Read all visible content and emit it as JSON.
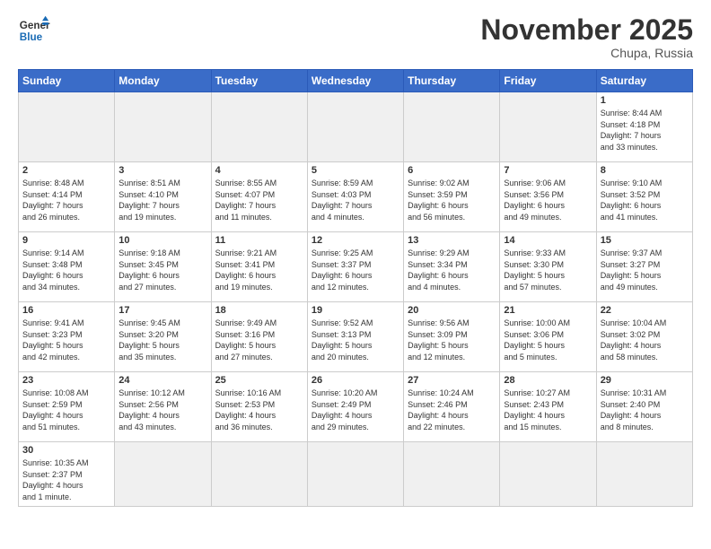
{
  "header": {
    "logo_text_normal": "General",
    "logo_text_bold": "Blue",
    "month_title": "November 2025",
    "location": "Chupa, Russia"
  },
  "weekdays": [
    "Sunday",
    "Monday",
    "Tuesday",
    "Wednesday",
    "Thursday",
    "Friday",
    "Saturday"
  ],
  "weeks": [
    [
      {
        "num": "",
        "info": "",
        "empty": true
      },
      {
        "num": "",
        "info": "",
        "empty": true
      },
      {
        "num": "",
        "info": "",
        "empty": true
      },
      {
        "num": "",
        "info": "",
        "empty": true
      },
      {
        "num": "",
        "info": "",
        "empty": true
      },
      {
        "num": "",
        "info": "",
        "empty": true
      },
      {
        "num": "1",
        "info": "Sunrise: 8:44 AM\nSunset: 4:18 PM\nDaylight: 7 hours\nand 33 minutes.",
        "empty": false
      }
    ],
    [
      {
        "num": "2",
        "info": "Sunrise: 8:48 AM\nSunset: 4:14 PM\nDaylight: 7 hours\nand 26 minutes.",
        "empty": false
      },
      {
        "num": "3",
        "info": "Sunrise: 8:51 AM\nSunset: 4:10 PM\nDaylight: 7 hours\nand 19 minutes.",
        "empty": false
      },
      {
        "num": "4",
        "info": "Sunrise: 8:55 AM\nSunset: 4:07 PM\nDaylight: 7 hours\nand 11 minutes.",
        "empty": false
      },
      {
        "num": "5",
        "info": "Sunrise: 8:59 AM\nSunset: 4:03 PM\nDaylight: 7 hours\nand 4 minutes.",
        "empty": false
      },
      {
        "num": "6",
        "info": "Sunrise: 9:02 AM\nSunset: 3:59 PM\nDaylight: 6 hours\nand 56 minutes.",
        "empty": false
      },
      {
        "num": "7",
        "info": "Sunrise: 9:06 AM\nSunset: 3:56 PM\nDaylight: 6 hours\nand 49 minutes.",
        "empty": false
      },
      {
        "num": "8",
        "info": "Sunrise: 9:10 AM\nSunset: 3:52 PM\nDaylight: 6 hours\nand 41 minutes.",
        "empty": false
      }
    ],
    [
      {
        "num": "9",
        "info": "Sunrise: 9:14 AM\nSunset: 3:48 PM\nDaylight: 6 hours\nand 34 minutes.",
        "empty": false
      },
      {
        "num": "10",
        "info": "Sunrise: 9:18 AM\nSunset: 3:45 PM\nDaylight: 6 hours\nand 27 minutes.",
        "empty": false
      },
      {
        "num": "11",
        "info": "Sunrise: 9:21 AM\nSunset: 3:41 PM\nDaylight: 6 hours\nand 19 minutes.",
        "empty": false
      },
      {
        "num": "12",
        "info": "Sunrise: 9:25 AM\nSunset: 3:37 PM\nDaylight: 6 hours\nand 12 minutes.",
        "empty": false
      },
      {
        "num": "13",
        "info": "Sunrise: 9:29 AM\nSunset: 3:34 PM\nDaylight: 6 hours\nand 4 minutes.",
        "empty": false
      },
      {
        "num": "14",
        "info": "Sunrise: 9:33 AM\nSunset: 3:30 PM\nDaylight: 5 hours\nand 57 minutes.",
        "empty": false
      },
      {
        "num": "15",
        "info": "Sunrise: 9:37 AM\nSunset: 3:27 PM\nDaylight: 5 hours\nand 49 minutes.",
        "empty": false
      }
    ],
    [
      {
        "num": "16",
        "info": "Sunrise: 9:41 AM\nSunset: 3:23 PM\nDaylight: 5 hours\nand 42 minutes.",
        "empty": false
      },
      {
        "num": "17",
        "info": "Sunrise: 9:45 AM\nSunset: 3:20 PM\nDaylight: 5 hours\nand 35 minutes.",
        "empty": false
      },
      {
        "num": "18",
        "info": "Sunrise: 9:49 AM\nSunset: 3:16 PM\nDaylight: 5 hours\nand 27 minutes.",
        "empty": false
      },
      {
        "num": "19",
        "info": "Sunrise: 9:52 AM\nSunset: 3:13 PM\nDaylight: 5 hours\nand 20 minutes.",
        "empty": false
      },
      {
        "num": "20",
        "info": "Sunrise: 9:56 AM\nSunset: 3:09 PM\nDaylight: 5 hours\nand 12 minutes.",
        "empty": false
      },
      {
        "num": "21",
        "info": "Sunrise: 10:00 AM\nSunset: 3:06 PM\nDaylight: 5 hours\nand 5 minutes.",
        "empty": false
      },
      {
        "num": "22",
        "info": "Sunrise: 10:04 AM\nSunset: 3:02 PM\nDaylight: 4 hours\nand 58 minutes.",
        "empty": false
      }
    ],
    [
      {
        "num": "23",
        "info": "Sunrise: 10:08 AM\nSunset: 2:59 PM\nDaylight: 4 hours\nand 51 minutes.",
        "empty": false
      },
      {
        "num": "24",
        "info": "Sunrise: 10:12 AM\nSunset: 2:56 PM\nDaylight: 4 hours\nand 43 minutes.",
        "empty": false
      },
      {
        "num": "25",
        "info": "Sunrise: 10:16 AM\nSunset: 2:53 PM\nDaylight: 4 hours\nand 36 minutes.",
        "empty": false
      },
      {
        "num": "26",
        "info": "Sunrise: 10:20 AM\nSunset: 2:49 PM\nDaylight: 4 hours\nand 29 minutes.",
        "empty": false
      },
      {
        "num": "27",
        "info": "Sunrise: 10:24 AM\nSunset: 2:46 PM\nDaylight: 4 hours\nand 22 minutes.",
        "empty": false
      },
      {
        "num": "28",
        "info": "Sunrise: 10:27 AM\nSunset: 2:43 PM\nDaylight: 4 hours\nand 15 minutes.",
        "empty": false
      },
      {
        "num": "29",
        "info": "Sunrise: 10:31 AM\nSunset: 2:40 PM\nDaylight: 4 hours\nand 8 minutes.",
        "empty": false
      }
    ],
    [
      {
        "num": "30",
        "info": "Sunrise: 10:35 AM\nSunset: 2:37 PM\nDaylight: 4 hours\nand 1 minute.",
        "empty": false
      },
      {
        "num": "",
        "info": "",
        "empty": true
      },
      {
        "num": "",
        "info": "",
        "empty": true
      },
      {
        "num": "",
        "info": "",
        "empty": true
      },
      {
        "num": "",
        "info": "",
        "empty": true
      },
      {
        "num": "",
        "info": "",
        "empty": true
      },
      {
        "num": "",
        "info": "",
        "empty": true
      }
    ]
  ]
}
